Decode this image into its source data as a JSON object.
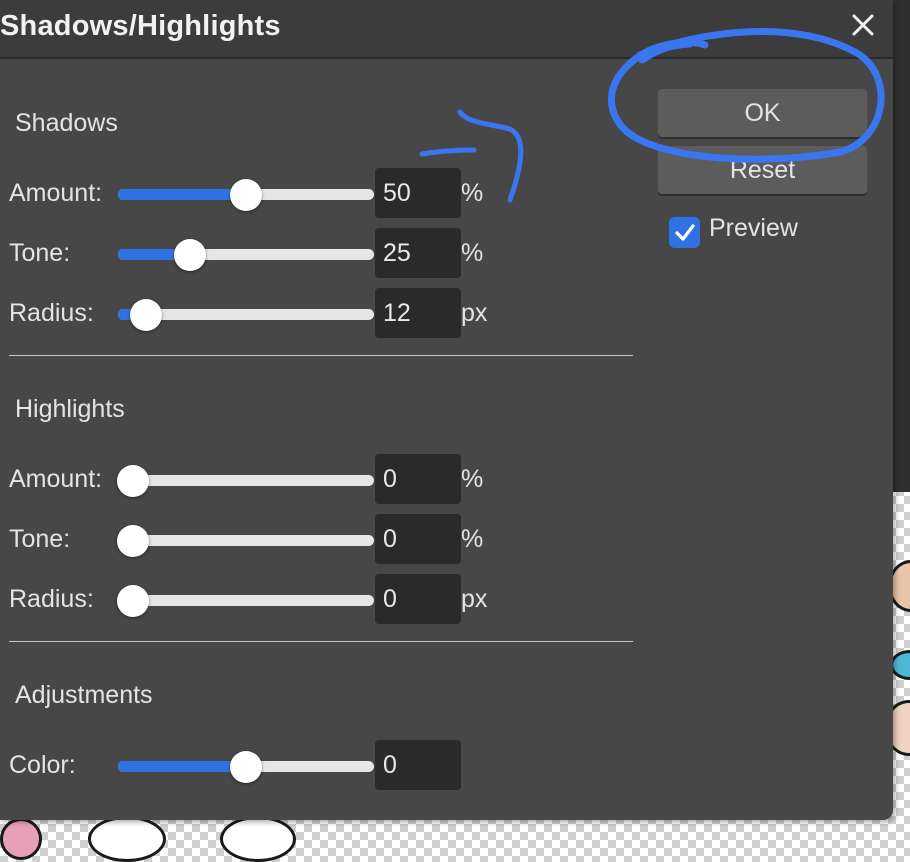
{
  "dialog": {
    "title": "Shadows/Highlights",
    "close_icon": "close-icon",
    "ok_label": "OK",
    "reset_label": "Reset",
    "preview_label": "Preview",
    "preview_checked": true
  },
  "shadows": {
    "title": "Shadows",
    "amount": {
      "label": "Amount:",
      "value": "50",
      "unit": "%",
      "level": 0.5
    },
    "tone": {
      "label": "Tone:",
      "value": "25",
      "unit": "%",
      "level": 0.28
    },
    "radius": {
      "label": "Radius:",
      "value": "12",
      "unit": "px",
      "level": 0.11
    }
  },
  "highlights": {
    "title": "Highlights",
    "amount": {
      "label": "Amount:",
      "value": "0",
      "unit": "%",
      "level": 0.06
    },
    "tone": {
      "label": "Tone:",
      "value": "0",
      "unit": "%",
      "level": 0.06
    },
    "radius": {
      "label": "Radius:",
      "value": "0",
      "unit": "px",
      "level": 0.06
    }
  },
  "adjustments": {
    "title": "Adjustments",
    "color": {
      "label": "Color:",
      "value": "0",
      "level": 0.5
    }
  },
  "colors": {
    "accent": "#2f72e4",
    "annotation": "#3a76f0",
    "dialog_bg": "#474747",
    "titlebar_bg": "#3c3c3c",
    "input_bg": "#2a2a2a"
  }
}
